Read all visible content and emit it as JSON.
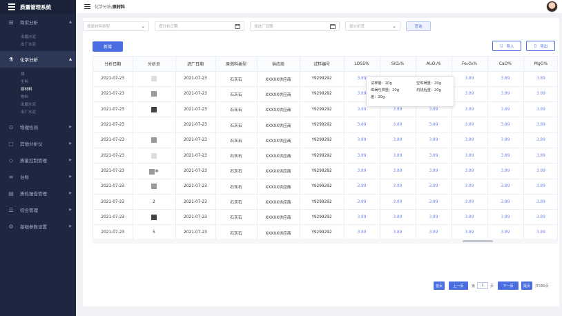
{
  "app": {
    "title": "质量管理系统"
  },
  "sidebar": {
    "items": [
      {
        "label": "简实分析",
        "icon": "grid-icon",
        "expanded": true,
        "children": [
          "出磨水泥",
          "出厂水泥"
        ]
      },
      {
        "label": "化学分析",
        "icon": "flask-icon",
        "expanded": true,
        "active": true,
        "children": [
          "煤",
          "生料",
          "原材料",
          "熟料",
          "出磨水泥",
          "出厂水泥"
        ],
        "active_child": "原材料"
      },
      {
        "label": "物理检测",
        "icon": "search-circle-icon"
      },
      {
        "label": "其他分析仪",
        "icon": "clipboard-icon"
      },
      {
        "label": "质量控制管理",
        "icon": "shield-icon"
      },
      {
        "label": "台账",
        "icon": "ledger-icon"
      },
      {
        "label": "质检报告管理",
        "icon": "report-icon"
      },
      {
        "label": "综合管理",
        "icon": "list-icon"
      },
      {
        "label": "基础参数设置",
        "icon": "gear-icon"
      }
    ]
  },
  "breadcrumb": {
    "parent": "化学分析",
    "separator": "/",
    "current": "原材料"
  },
  "filters": {
    "material_type_placeholder": "按原材料类型",
    "analysis_date_placeholder": "按分析日期",
    "arrival_date_placeholder": "按进厂日期",
    "analyst_placeholder": "按分析员",
    "query_label": "查询"
  },
  "toolbar": {
    "add_label": "新增",
    "import_label": "导入",
    "export_label": "导出"
  },
  "table": {
    "headers": [
      "分析日期",
      "分析员",
      "进厂日期",
      "原燃料类型",
      "供应商",
      "试样编号",
      "LOSS%",
      "SiO₂%",
      "Al₂O₃%",
      "Fe₂O₃%",
      "CaO%",
      "MgO%"
    ],
    "rows": [
      {
        "analysis_date": "2021-07-23",
        "analyst": "",
        "arrival_date": "2021-07-23",
        "type": "石灰石",
        "supplier": "XXXXX供应商",
        "sample_no": "Y9299292",
        "loss": "3.89",
        "sio2": "3.89",
        "al2o3": "3.89",
        "fe2o3": "3.89",
        "cao": "3.89",
        "mgo": "3.89"
      },
      {
        "analysis_date": "2021-07-23",
        "analyst": "",
        "arrival_date": "2021-07-23",
        "type": "石灰石",
        "supplier": "XXXXX供应商",
        "sample_no": "Y9299292",
        "loss": "3.89",
        "sio2": "3.89",
        "al2o3": "3.89",
        "fe2o3": "3.89",
        "cao": "3.89",
        "mgo": "3.89"
      },
      {
        "analysis_date": "2021-07-23",
        "analyst": "",
        "arrival_date": "2021-07-23",
        "type": "石灰石",
        "supplier": "XXXXX供应商",
        "sample_no": "Y9299292",
        "loss": "3.89",
        "sio2": "3.89",
        "al2o3": "3.89",
        "fe2o3": "3.89",
        "cao": "3.89",
        "mgo": "3.89"
      },
      {
        "analysis_date": "2021-07-23",
        "analyst": "",
        "arrival_date": "2021-07-23",
        "type": "石灰石",
        "supplier": "XXXXX供应商",
        "sample_no": "Y9299292",
        "loss": "3.89",
        "sio2": "3.89",
        "al2o3": "3.89",
        "fe2o3": "3.89",
        "cao": "3.89",
        "mgo": "3.89"
      },
      {
        "analysis_date": "2021-07-23",
        "analyst": "",
        "arrival_date": "2021-07-23",
        "type": "石灰石",
        "supplier": "XXXXX供应商",
        "sample_no": "Y9299292",
        "loss": "3.89",
        "sio2": "3.89",
        "al2o3": "3.89",
        "fe2o3": "3.89",
        "cao": "3.89",
        "mgo": "3.89"
      },
      {
        "analysis_date": "2021-07-23",
        "analyst": "",
        "arrival_date": "2021-07-23",
        "type": "石灰石",
        "supplier": "XXXXX供应商",
        "sample_no": "Y9299292",
        "loss": "3.89",
        "sio2": "3.89",
        "al2o3": "3.89",
        "fe2o3": "3.89",
        "cao": "3.89",
        "mgo": "3.89"
      },
      {
        "analysis_date": "2021-07-23",
        "analyst": "丰",
        "arrival_date": "2021-07-23",
        "type": "石灰石",
        "supplier": "XXXXX供应商",
        "sample_no": "Y9299292",
        "loss": "3.89",
        "sio2": "3.89",
        "al2o3": "3.89",
        "fe2o3": "3.89",
        "cao": "3.89",
        "mgo": "3.89"
      },
      {
        "analysis_date": "2021-07-23",
        "analyst": "",
        "arrival_date": "2021-07-23",
        "type": "石灰石",
        "supplier": "XXXXX供应商",
        "sample_no": "Y9299292",
        "loss": "3.89",
        "sio2": "3.89",
        "al2o3": "3.89",
        "fe2o3": "3.89",
        "cao": "3.89",
        "mgo": "3.89"
      },
      {
        "analysis_date": "2021-07-23",
        "analyst": "2",
        "arrival_date": "2021-07-23",
        "type": "石灰石",
        "supplier": "XXXXX供应商",
        "sample_no": "Y9299292",
        "loss": "3.89",
        "sio2": "3.89",
        "al2o3": "3.89",
        "fe2o3": "3.89",
        "cao": "3.89",
        "mgo": "3.89"
      },
      {
        "analysis_date": "2021-07-23",
        "analyst": "",
        "arrival_date": "2021-07-23",
        "type": "石灰石",
        "supplier": "XXXXX供应商",
        "sample_no": "Y9299292",
        "loss": "3.89",
        "sio2": "3.89",
        "al2o3": "3.89",
        "fe2o3": "3.89",
        "cao": "3.89",
        "mgo": "3.89"
      },
      {
        "analysis_date": "2021-07-23",
        "analyst": "5",
        "arrival_date": "2021-07-23",
        "type": "石灰石",
        "supplier": "XXXXX供应商",
        "sample_no": "Y9299292",
        "loss": "3.89",
        "sio2": "3.89",
        "al2o3": "3.89",
        "fe2o3": "3.89",
        "cao": "3.89",
        "mgo": "3.89"
      }
    ]
  },
  "tooltip": {
    "sample_weight": "试样量：20g",
    "empty_crucible": "空坩埚重：20g",
    "crucible_sample": "坩埚与样重：20g",
    "after_burn": "灼烧后重：20g",
    "diff": "差：20g"
  },
  "pagination": {
    "first": "首页",
    "prev": "上一页",
    "page_prefix": "第",
    "page_value": "1",
    "page_suffix": "页",
    "next": "下一页",
    "last": "尾页",
    "total": "共580页"
  },
  "colors": {
    "sidebar_bg": "#1d2740",
    "primary": "#4a6ee0",
    "link_value": "#6f87e6"
  }
}
